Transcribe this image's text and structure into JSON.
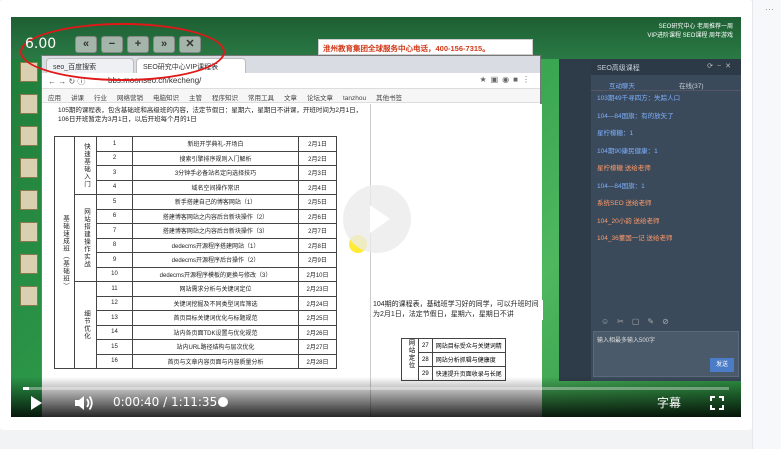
{
  "player": {
    "speed": "6.00",
    "speed_buttons": [
      "«",
      "−",
      "+",
      "»",
      "✕"
    ],
    "current_time": "0:00:40",
    "separator": " / ",
    "duration": "1:11:35",
    "subtitle_label": "字幕",
    "progress_fraction": 0.009
  },
  "banner": {
    "text": "淮州教育集团全球服务中心电话，400-156-7315。"
  },
  "topright": {
    "line1": "SEO研究中心 老周推荐一周",
    "line2": "VIP进阶课程  SEO课程  周年游戏"
  },
  "browser": {
    "tabs": [
      "seo_百度搜索",
      "SEO研究中心VIP课程表"
    ],
    "url": "bbs.moonseo.cn/kecheng/",
    "bookmarks": [
      "应用",
      "讲课",
      "行业",
      "网络营销",
      "电脑知识",
      "主管",
      "程序知识",
      "常用工具",
      "文章",
      "论坛文章",
      "tanzhou",
      "其他书签"
    ],
    "intro": "105期的课程表，包含基础班和高级班的内容，法定节假日：星期六，星期日不讲课，开班时间为2月1日，106日开班暂定为3月1日，以后开班每个月的1日",
    "group_basic": "基础速成班（基础班）",
    "cat1": "快速基础入门",
    "cat2": "网站搭建操作实战",
    "cat3": "细节优化",
    "rows": [
      {
        "n": "1",
        "t": "新班开学典礼-开场白",
        "d": "2月1日"
      },
      {
        "n": "2",
        "t": "搜索引擎排序规则入门解析",
        "d": "2月2日"
      },
      {
        "n": "3",
        "t": "3分钟手必备站名定向选择技巧",
        "d": "2月3日"
      },
      {
        "n": "4",
        "t": "域名空间操作常识",
        "d": "2月4日"
      },
      {
        "n": "5",
        "t": "新手搭建自己的博客网站（1）",
        "d": "2月5日"
      },
      {
        "n": "6",
        "t": "搭建博客网站之内容后台新块操作（2）",
        "d": "2月6日"
      },
      {
        "n": "7",
        "t": "搭建博客网站之内容后台新块操作（3）",
        "d": "2月7日"
      },
      {
        "n": "8",
        "t": "dedecms开源程序搭建网站（1）",
        "d": "2月8日"
      },
      {
        "n": "9",
        "t": "dedecms开源程序后台操作（2）",
        "d": "2月9日"
      },
      {
        "n": "10",
        "t": "dedecms开源程序模板的更换与修改（3）",
        "d": "2月10日"
      },
      {
        "n": "11",
        "t": "网站需求分析与关键词定位",
        "d": "2月23日"
      },
      {
        "n": "12",
        "t": "关键词挖掘及不同类型词库筛选",
        "d": "2月24日"
      },
      {
        "n": "13",
        "t": "首页目标关键词优化与标题规范",
        "d": "2月25日"
      },
      {
        "n": "14",
        "t": "站内各页面TDK设置与优化规范",
        "d": "2月26日"
      },
      {
        "n": "15",
        "t": "站内URL路径结构与层次优化",
        "d": "2月27日"
      },
      {
        "n": "16",
        "t": "首页与文章内容页面与内容质量分析",
        "d": "2月28日"
      }
    ],
    "side_intro": "104期的课程表，基础班学习好的同学，可以升班时间为2月1日，法定节假日，星期六，星期日不讲",
    "side_cat": "网站定位",
    "side_rows": [
      {
        "n": "27",
        "t": "网站目标受众与关键词精"
      },
      {
        "n": "28",
        "t": "网站分析抓辑与健康度"
      },
      {
        "n": "29",
        "t": "快速提升页面收录与长尾"
      }
    ]
  },
  "chat": {
    "title": "SEO高级课程",
    "tab_chat": "互动聊天",
    "tab_online": "在线(37)",
    "messages": [
      {
        "text": "103期49千寻四方：失踪人口",
        "s": false
      },
      {
        "text": "104—84国旗：有的放矢了",
        "s": false
      },
      {
        "text": "星柠檬糖：1",
        "s": false
      },
      {
        "text": "104期90康民健康：1",
        "s": false
      },
      {
        "text": "星柠檬糖 送给老师",
        "s": true
      },
      {
        "text": "104—84国旗：1",
        "s": false
      },
      {
        "text": "系统SEO 送给老师",
        "s": true
      },
      {
        "text": "104_20小韵 送给老师",
        "s": true
      },
      {
        "text": "104_36董国一记 送给老师",
        "s": true
      }
    ],
    "input_placeholder": "输入相最多输入500字",
    "send_label": "发送"
  }
}
